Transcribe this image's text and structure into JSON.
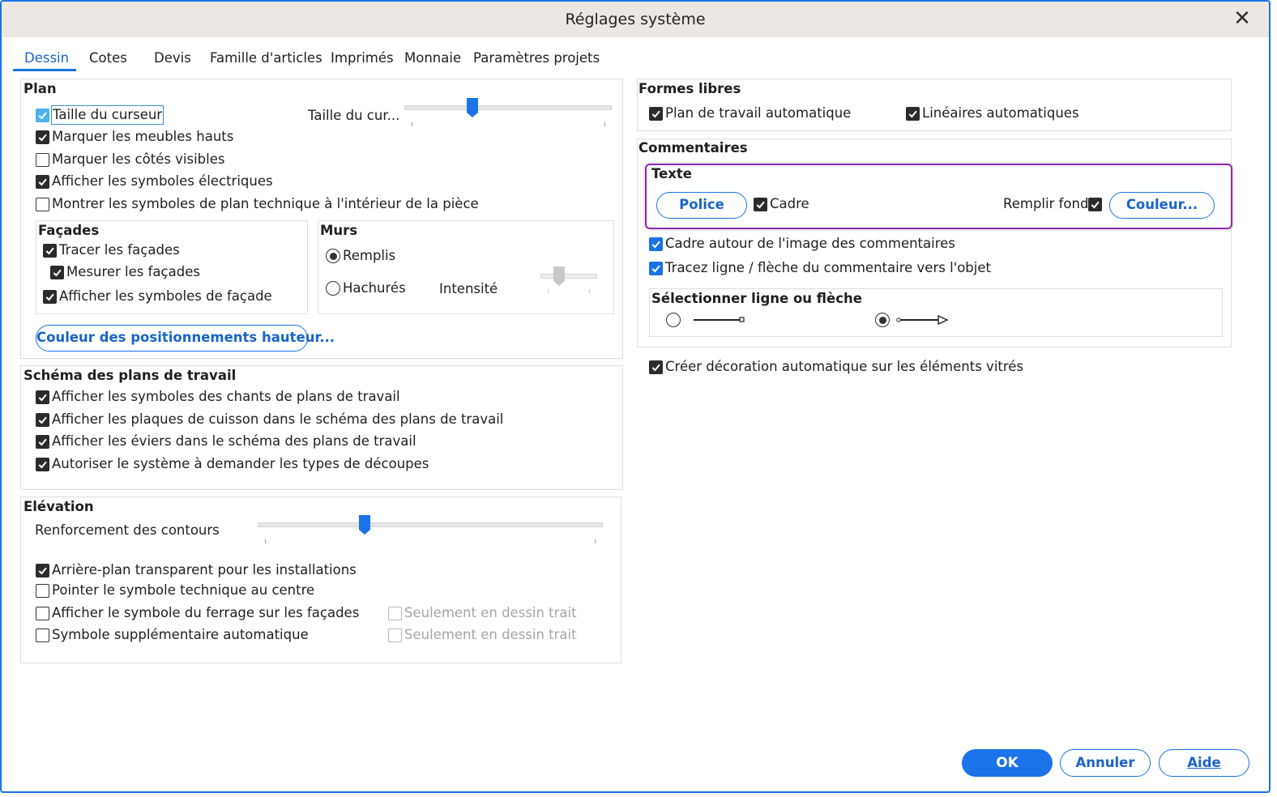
{
  "window": {
    "title": "Réglages système",
    "close_glyph": "✕"
  },
  "tabs": [
    {
      "label": "Dessin",
      "active": true
    },
    {
      "label": "Cotes"
    },
    {
      "label": "Devis"
    },
    {
      "label": "Famille d'articles"
    },
    {
      "label": "Imprimés"
    },
    {
      "label": "Monnaie"
    },
    {
      "label": "Paramètres projets"
    }
  ],
  "plan": {
    "title": "Plan",
    "checkboxes": [
      {
        "label": "Taille du curseur",
        "checked": true
      },
      {
        "label": "Marquer les meubles hauts",
        "checked": true
      },
      {
        "label": "Marquer les côtés visibles",
        "checked": false
      },
      {
        "label": "Afficher les symboles électriques",
        "checked": true
      },
      {
        "label": "Montrer les symboles de plan technique à l'intérieur de la pièce",
        "checked": false
      }
    ],
    "cursor_size_label": "Taille du cur...",
    "cursor_size_level": 0.33,
    "facades": {
      "title": "Façades",
      "checkboxes": [
        {
          "label": "Tracer les façades",
          "checked": true
        },
        {
          "label": "Mesurer les façades",
          "checked": true
        },
        {
          "label": "Afficher les symboles de façade",
          "checked": true
        }
      ]
    },
    "murs": {
      "title": "Murs",
      "radios": [
        {
          "label": "Remplis",
          "selected": true
        },
        {
          "label": "Hachurés",
          "selected": false
        }
      ],
      "intensity_label": "Intensité"
    },
    "color_button": "Couleur des positionnements hauteur..."
  },
  "schema": {
    "title": "Schéma des plans de travail",
    "checkboxes": [
      {
        "label": "Afficher les symboles des chants de plans de travail",
        "checked": true
      },
      {
        "label": "Afficher les plaques de cuisson dans le schéma des plans de travail",
        "checked": true
      },
      {
        "label": "Afficher les éviers dans le schéma des plans de travail",
        "checked": true
      },
      {
        "label": "Autoriser le système à demander les types de découpes",
        "checked": true
      }
    ]
  },
  "elevation": {
    "title": "Elévation",
    "contour_label": "Renforcement des contours",
    "contour_level": 0.31,
    "checkboxes": [
      {
        "label": "Arrière-plan transparent pour les installations",
        "checked": true
      },
      {
        "label": "Pointer le symbole technique au centre",
        "checked": false
      },
      {
        "label": "Afficher le symbole du ferrage sur les façades",
        "checked": false
      },
      {
        "label": "Symbole supplémentaire automatique",
        "checked": false
      }
    ],
    "only_line_label_1": "Seulement en dessin trait",
    "only_line_label_2": "Seulement en dessin trait"
  },
  "formes_libres": {
    "title": "Formes libres",
    "checkboxes": [
      {
        "label": "Plan de travail automatique",
        "checked": true
      },
      {
        "label": "Linéaires automatiques",
        "checked": true
      }
    ]
  },
  "commentaires": {
    "title": "Commentaires",
    "texte": {
      "title": "Texte",
      "font_button": "Police",
      "frame_label": "Cadre",
      "frame_checked": true,
      "fill_label": "Remplir fond",
      "fill_checked": true,
      "color_button": "Couleur..."
    },
    "checkboxes": [
      {
        "label": "Cadre autour de l'image des commentaires",
        "checked": true
      },
      {
        "label": "Tracez ligne / flèche du commentaire vers l'objet",
        "checked": true
      }
    ],
    "line_select": {
      "title": "Sélectionner ligne ou flèche",
      "options": [
        {
          "name": "line",
          "selected": false
        },
        {
          "name": "arrow",
          "selected": true
        }
      ]
    }
  },
  "decoration": {
    "label": "Créer décoration automatique sur les éléments vitrés",
    "checked": true
  },
  "footer": {
    "ok": "OK",
    "cancel": "Annuler",
    "help": "Aide"
  },
  "colors": {
    "accent": "#1a73e8",
    "highlight": "#8e2bb5",
    "titlebar": "#ede7e3"
  }
}
